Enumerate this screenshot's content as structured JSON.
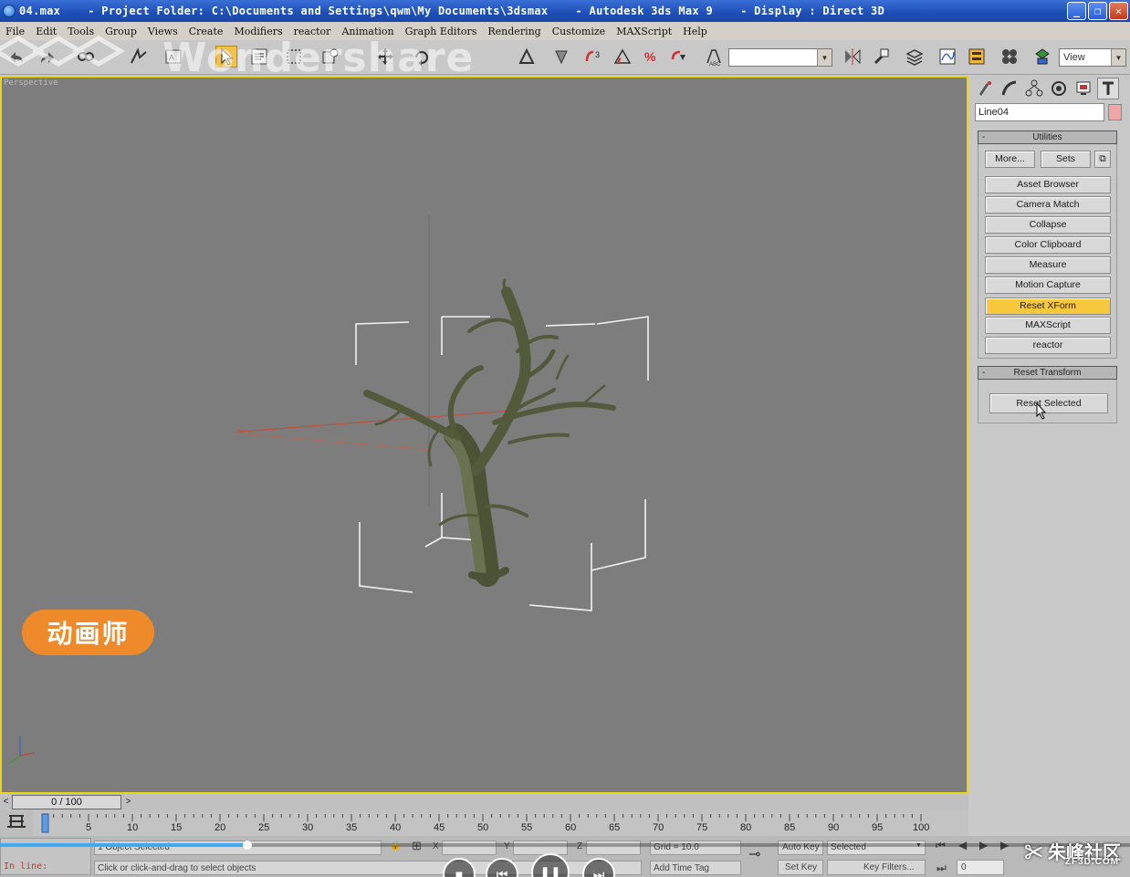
{
  "window": {
    "title": "04.max    - Project Folder: C:\\Documents and Settings\\qwm\\My Documents\\3dsmax    - Autodesk 3ds Max 9    - Display : Direct 3D"
  },
  "menu": [
    "File",
    "Edit",
    "Tools",
    "Group",
    "Views",
    "Create",
    "Modifiers",
    "reactor",
    "Animation",
    "Graph Editors",
    "Rendering",
    "Customize",
    "MAXScript",
    "Help"
  ],
  "toolbar": {
    "named_selection_value": "",
    "reference_coord": "View"
  },
  "watermark": "Wondershare",
  "viewport": {
    "label": "Perspective"
  },
  "command_panel": {
    "object_name": "Line04",
    "utilities": {
      "header": "Utilities",
      "more_label": "More...",
      "sets_label": "Sets",
      "buttons": [
        "Asset Browser",
        "Camera Match",
        "Collapse",
        "Color Clipboard",
        "Measure",
        "Motion Capture",
        "Reset XForm",
        "MAXScript",
        "reactor"
      ],
      "active": "Reset XForm"
    },
    "reset_transform": {
      "header": "Reset Transform",
      "button_label": "Reset Selected"
    }
  },
  "time_slider": {
    "position_text": "0 / 100",
    "ticks": [
      "0",
      "5",
      "10",
      "15",
      "20",
      "25",
      "30",
      "35",
      "40",
      "45",
      "50",
      "55",
      "60",
      "65",
      "70",
      "75",
      "80",
      "85",
      "90",
      "95",
      "100"
    ]
  },
  "status": {
    "selected": "1 Object Selected",
    "prompt": "Click or click-and-drag to select objects",
    "listener": "In line:",
    "x_label": "X",
    "y_label": "Y",
    "z_label": "Z",
    "grid": "Grid = 10.0",
    "add_time_tag": "Add Time Tag",
    "auto_key": "Auto Key",
    "set_key": "Set Key",
    "selected_dropdown": "Selected",
    "key_filters": "Key Filters...",
    "frame": "0"
  },
  "overlays": {
    "logo_text": "动画师",
    "site_name": "朱峰社区",
    "site_domain": "ZF3D.COM",
    "player_progress": 0.219
  }
}
